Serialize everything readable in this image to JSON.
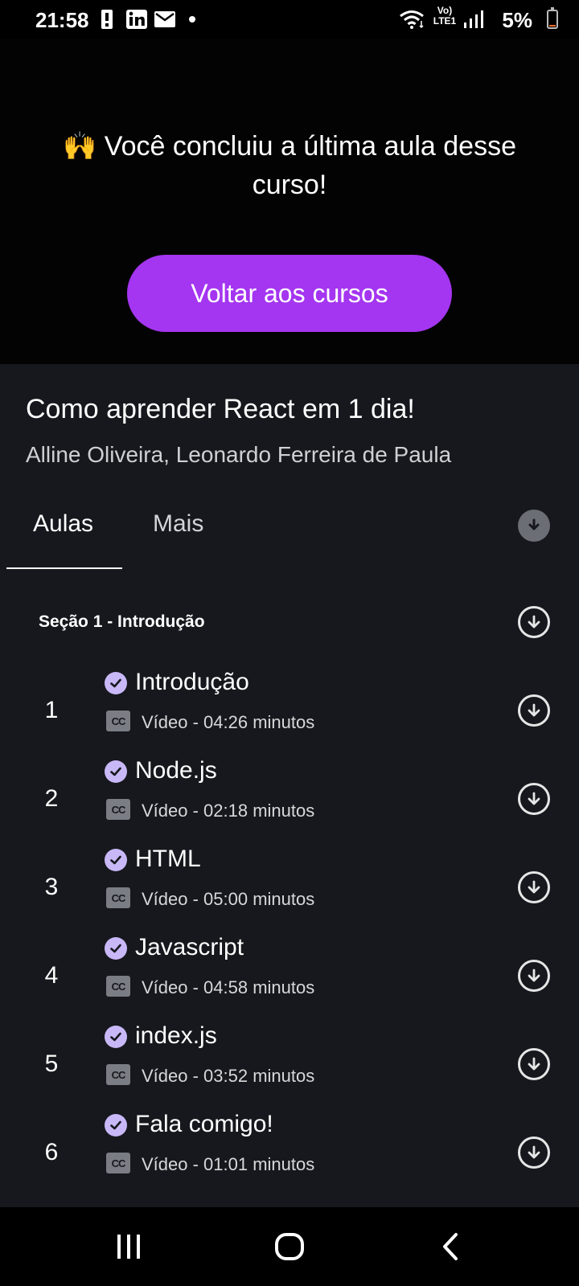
{
  "status_bar": {
    "time": "21:58",
    "battery_percent": "5%",
    "battery_level": 0.05,
    "network": "Vo) LTE1",
    "icons": [
      "alert-icon",
      "linkedin-icon",
      "mail-icon",
      "dot-icon",
      "wifi-icon",
      "signal-icon",
      "battery-icon"
    ]
  },
  "hero": {
    "emoji": "🙌",
    "message": "Você concluiu a última aula desse curso!",
    "button_label": "Voltar aos cursos"
  },
  "course": {
    "title": "Como aprender React em 1 dia!",
    "authors": "Alline Oliveira, Leonardo Ferreira de Paula"
  },
  "tabs": [
    {
      "label": "Aulas",
      "active": true
    },
    {
      "label": "Mais",
      "active": false
    }
  ],
  "section": {
    "title": "Seção 1 - Introdução"
  },
  "lessons": [
    {
      "number": "1",
      "title": "Introdução",
      "meta": "Vídeo - 04:26 minutos",
      "completed": true
    },
    {
      "number": "2",
      "title": "Node.js",
      "meta": "Vídeo - 02:18 minutos",
      "completed": true
    },
    {
      "number": "3",
      "title": "HTML",
      "meta": "Vídeo - 05:00 minutos",
      "completed": true
    },
    {
      "number": "4",
      "title": "Javascript",
      "meta": "Vídeo - 04:58 minutos",
      "completed": true
    },
    {
      "number": "5",
      "title": "index.js",
      "meta": "Vídeo - 03:52 minutos",
      "completed": true
    },
    {
      "number": "6",
      "title": "Fala comigo!",
      "meta": "Vídeo - 01:01 minutos",
      "completed": true
    }
  ],
  "cc_label": "CC",
  "colors": {
    "accent": "#a435f0",
    "check": "#c9b8f7",
    "background": "#16181d",
    "hero_background": "#030303"
  },
  "nav": [
    "recents-icon",
    "home-icon",
    "back-icon"
  ]
}
